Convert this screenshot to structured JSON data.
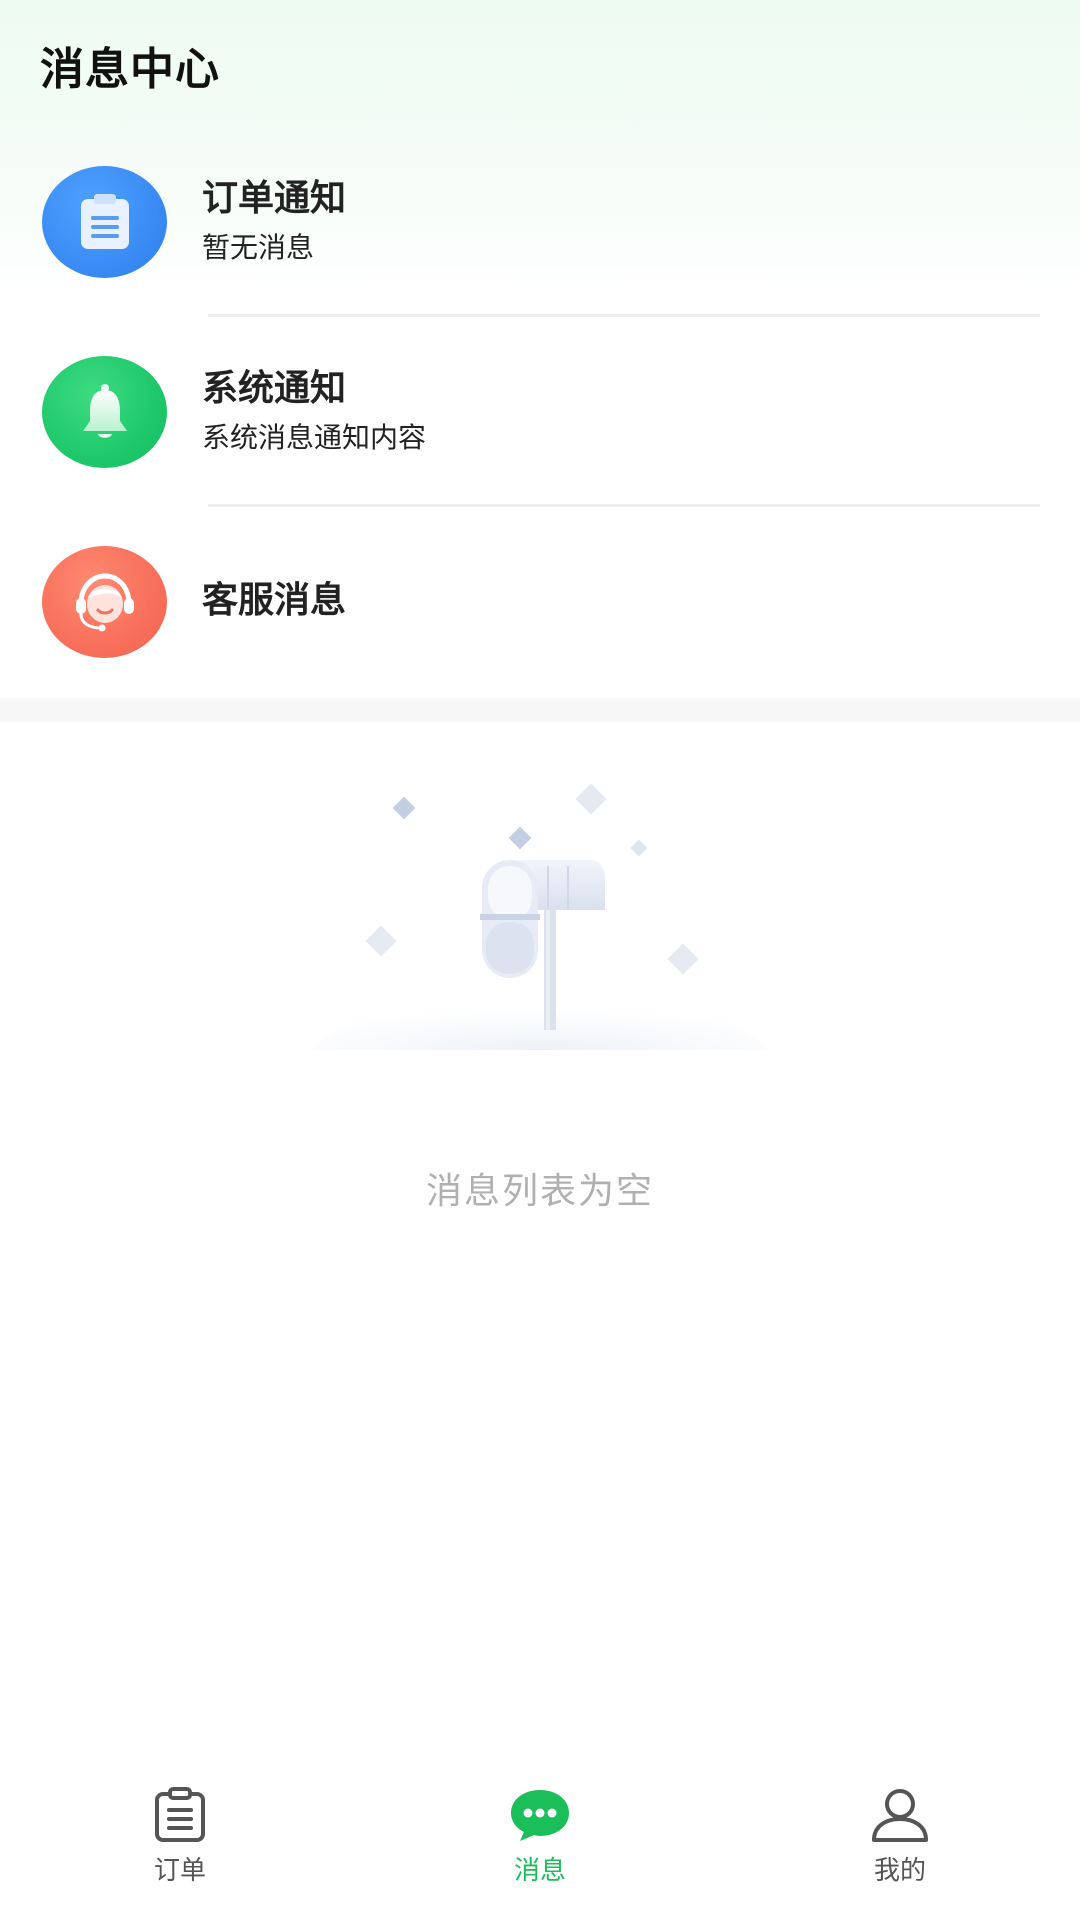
{
  "header": {
    "title": "消息中心"
  },
  "messages": [
    {
      "title": "订单通知",
      "subtitle": "暂无消息",
      "icon": "clipboard-icon",
      "color": "#3a8cf4"
    },
    {
      "title": "系统通知",
      "subtitle": "系统消息通知内容",
      "icon": "bell-icon",
      "color": "#1ec96a"
    },
    {
      "title": "客服消息",
      "subtitle": "",
      "icon": "customer-service-icon",
      "color": "#f86f5a"
    }
  ],
  "empty_state": {
    "text": "消息列表为空",
    "icon": "mailbox-icon"
  },
  "tabbar": {
    "tabs": [
      {
        "label": "订单",
        "icon": "order-list-icon",
        "active": false
      },
      {
        "label": "消息",
        "icon": "chat-bubble-icon",
        "active": true
      },
      {
        "label": "我的",
        "icon": "profile-icon",
        "active": false
      }
    ],
    "active_color": "#1bbf5a"
  }
}
